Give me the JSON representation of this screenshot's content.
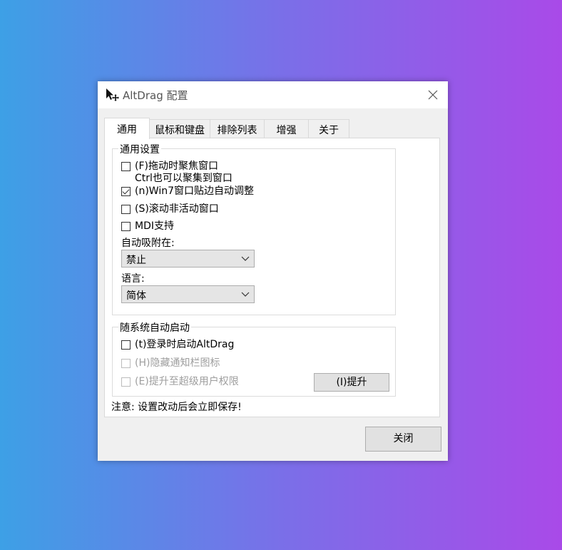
{
  "window": {
    "title": "AltDrag 配置",
    "close_glyph": "✕"
  },
  "tabs": [
    {
      "label": "通用",
      "active": true
    },
    {
      "label": "鼠标和键盘",
      "active": false
    },
    {
      "label": "排除列表",
      "active": false
    },
    {
      "label": "增强",
      "active": false
    },
    {
      "label": "关于",
      "active": false
    }
  ],
  "general": {
    "legend": "通用设置",
    "focus_on_drag": {
      "label": "(F)拖动时聚焦窗口",
      "sub": "Ctrl也可以聚集到窗口",
      "checked": false
    },
    "aero_snap": {
      "label": "(n)Win7窗口贴边自动调整",
      "checked": true
    },
    "scroll_inactive": {
      "label": "(S)滚动非活动窗口",
      "checked": false
    },
    "mdi": {
      "label": "MDI支持",
      "checked": false
    },
    "snap_label": "自动吸附在:",
    "snap_value": "禁止",
    "language_label": "语言:",
    "language_value": "简体"
  },
  "autostart": {
    "legend": "随系统自动启动",
    "on_login": {
      "label": "(t)登录时启动AltDrag",
      "checked": false
    },
    "hide_tray": {
      "label": "(H)隐藏通知栏图标",
      "checked": false,
      "disabled": true
    },
    "elevate": {
      "label": "(E)提升至超级用户权限",
      "checked": false,
      "disabled": true
    },
    "elevate_button": "(I)提升"
  },
  "note": "注意: 设置改动后会立即保存!",
  "close_button": "关闭",
  "colors": {
    "gradient_left": "#3da0e6",
    "gradient_right": "#a94ae8",
    "window_bg": "#f0f0f0"
  }
}
